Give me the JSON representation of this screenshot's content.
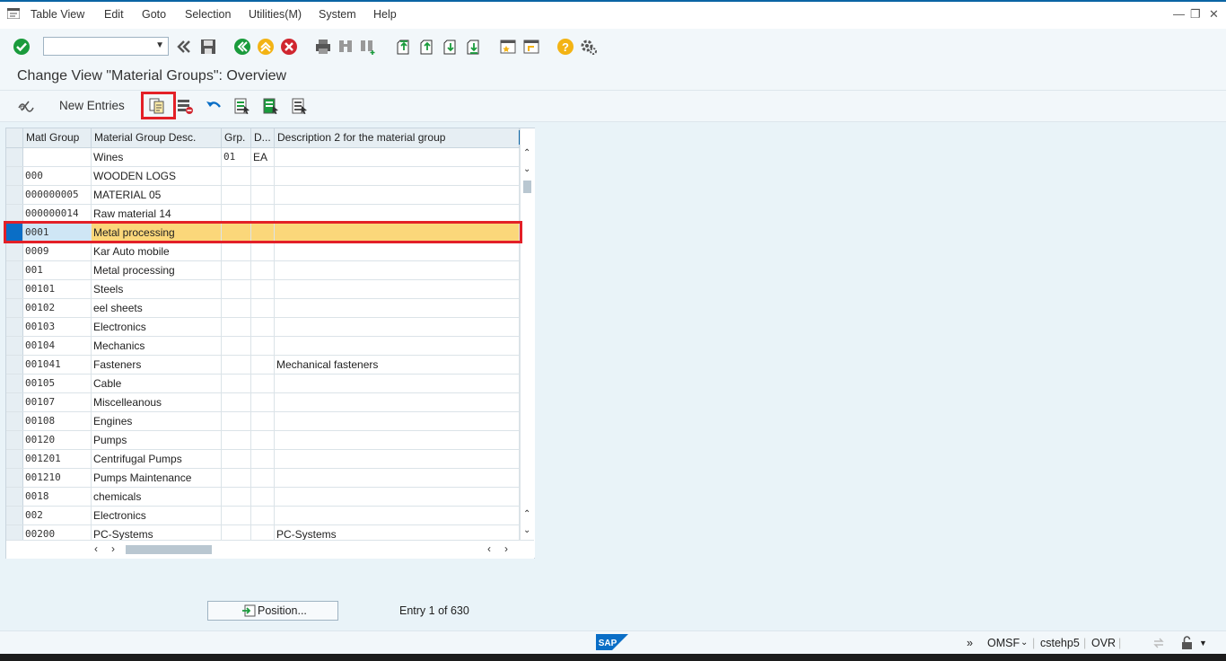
{
  "menu": {
    "items": [
      "Table View",
      "Edit",
      "Goto",
      "Selection",
      "Utilities(M)",
      "System",
      "Help"
    ]
  },
  "toolbar": {
    "command_field_value": ""
  },
  "page": {
    "title": "Change View \"Material Groups\": Overview"
  },
  "app_toolbar": {
    "new_entries_label": "New Entries"
  },
  "table": {
    "columns": [
      "Matl Group",
      "Material Group Desc.",
      "Grp.",
      "D...",
      "Description 2 for the material group"
    ],
    "rows": [
      {
        "group": "",
        "desc": "Wines",
        "grp": "01",
        "d": "EA",
        "desc2": ""
      },
      {
        "group": "000",
        "desc": "WOODEN LOGS",
        "grp": "",
        "d": "",
        "desc2": ""
      },
      {
        "group": "000000005",
        "desc": "MATERIAL 05",
        "grp": "",
        "d": "",
        "desc2": ""
      },
      {
        "group": "000000014",
        "desc": "Raw material 14",
        "grp": "",
        "d": "",
        "desc2": ""
      },
      {
        "group": "0001",
        "desc": "Metal processing",
        "grp": "",
        "d": "",
        "desc2": "",
        "selected": true
      },
      {
        "group": "0009",
        "desc": "Kar Auto mobile",
        "grp": "",
        "d": "",
        "desc2": ""
      },
      {
        "group": "001",
        "desc": "Metal processing",
        "grp": "",
        "d": "",
        "desc2": ""
      },
      {
        "group": "00101",
        "desc": "Steels",
        "grp": "",
        "d": "",
        "desc2": ""
      },
      {
        "group": "00102",
        "desc": "eel sheets",
        "grp": "",
        "d": "",
        "desc2": ""
      },
      {
        "group": "00103",
        "desc": "Electronics",
        "grp": "",
        "d": "",
        "desc2": ""
      },
      {
        "group": "00104",
        "desc": "Mechanics",
        "grp": "",
        "d": "",
        "desc2": ""
      },
      {
        "group": "001041",
        "desc": "Fasteners",
        "grp": "",
        "d": "",
        "desc2": "Mechanical fasteners"
      },
      {
        "group": "00105",
        "desc": "Cable",
        "grp": "",
        "d": "",
        "desc2": ""
      },
      {
        "group": "00107",
        "desc": "Miscelleanous",
        "grp": "",
        "d": "",
        "desc2": ""
      },
      {
        "group": "00108",
        "desc": "Engines",
        "grp": "",
        "d": "",
        "desc2": ""
      },
      {
        "group": "00120",
        "desc": "Pumps",
        "grp": "",
        "d": "",
        "desc2": ""
      },
      {
        "group": "001201",
        "desc": "Centrifugal Pumps",
        "grp": "",
        "d": "",
        "desc2": ""
      },
      {
        "group": "001210",
        "desc": "Pumps Maintenance",
        "grp": "",
        "d": "",
        "desc2": ""
      },
      {
        "group": "0018",
        "desc": "chemicals",
        "grp": "",
        "d": "",
        "desc2": ""
      },
      {
        "group": "002",
        "desc": "Electronics",
        "grp": "",
        "d": "",
        "desc2": ""
      },
      {
        "group": "00200",
        "desc": "PC-Systems",
        "grp": "",
        "d": "",
        "desc2": "PC-Systems"
      }
    ]
  },
  "footer": {
    "position_label": "Position...",
    "entry_text": "Entry 1 of 630"
  },
  "status": {
    "logo": "SAP",
    "items": [
      "OMSF",
      "cstehp5",
      "OVR"
    ]
  },
  "colors": {
    "accent": "#0a64a4",
    "selected_row": "#fbd77a",
    "highlight": "#e32027",
    "ok_green": "#1a9b3c",
    "cancel_red": "#d0262f",
    "nav_yellow": "#f3b314"
  }
}
